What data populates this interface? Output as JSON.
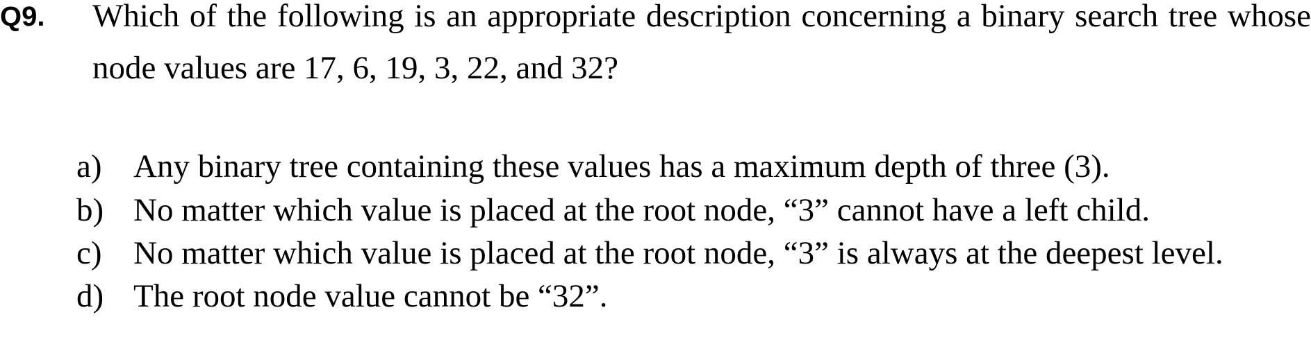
{
  "question": {
    "number": "Q9.",
    "text": "Which of the following is an appropriate description concerning a binary search tree whose node values are 17, 6, 19, 3, 22, and 32?"
  },
  "options": [
    {
      "letter": "a)",
      "text": "Any binary tree containing these values has a maximum depth of three (3)."
    },
    {
      "letter": "b)",
      "text": "No matter which value is placed at the root node, “3” cannot have a left child."
    },
    {
      "letter": "c)",
      "text": "No matter which value is placed at the root node, “3” is always at the deepest level."
    },
    {
      "letter": "d)",
      "text": "The root node value cannot be “32”."
    }
  ]
}
